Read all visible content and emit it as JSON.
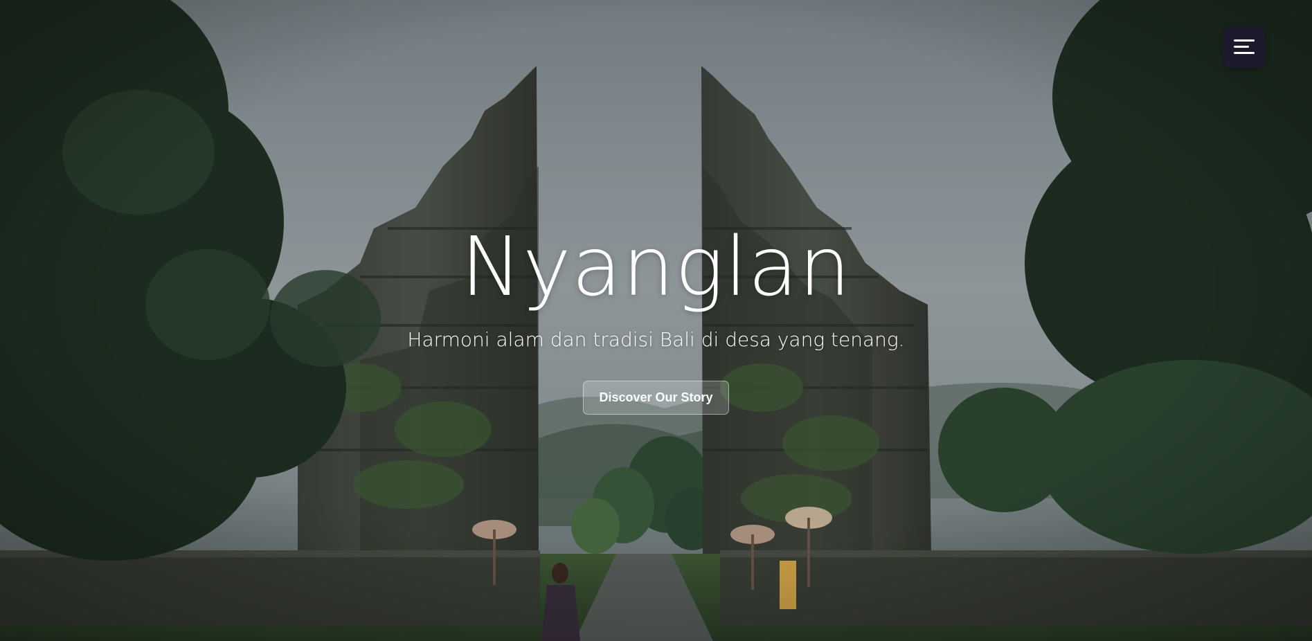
{
  "hero": {
    "title": "Nyanglan",
    "subtitle": "Harmoni alam dan tradisi Bali di desa yang tenang.",
    "cta_label": "Discover Our Story",
    "background_image": "balinese-split-gate-photo"
  },
  "header": {
    "menu_icon": "hamburger-menu-icon"
  },
  "colors": {
    "menu_button_bg": "#1d1a2e",
    "text": "#ffffff",
    "sky": "#8a9499",
    "foliage": "#2a3a2c"
  }
}
